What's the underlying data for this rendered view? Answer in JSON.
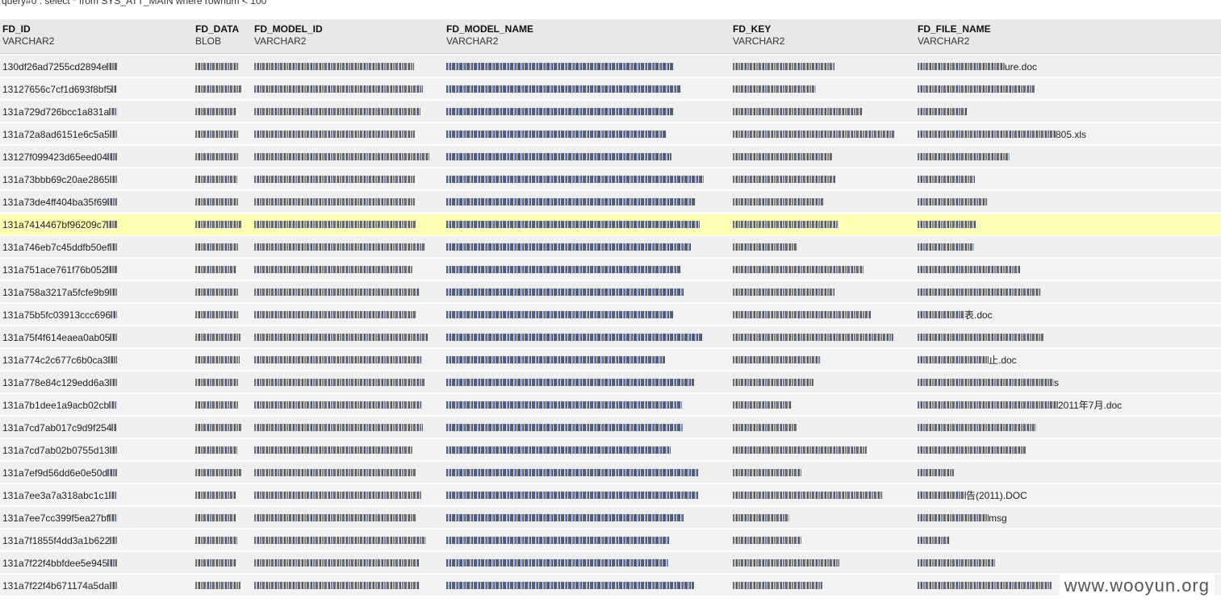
{
  "query": "query#0 : select * from SYS_ATT_MAIN where rownum < 100",
  "columns": [
    {
      "name": "FD_ID",
      "type": "VARCHAR2"
    },
    {
      "name": "FD_DATA",
      "type": "BLOB"
    },
    {
      "name": "FD_MODEL_ID",
      "type": "VARCHAR2"
    },
    {
      "name": "FD_MODEL_NAME",
      "type": "VARCHAR2"
    },
    {
      "name": "FD_KEY",
      "type": "VARCHAR2"
    },
    {
      "name": "FD_FILE_NAME",
      "type": "VARCHAR2"
    }
  ],
  "rows": [
    {
      "fd_id": "130df26ad7255cd2894e",
      "file_suffix": "ure.doc"
    },
    {
      "fd_id": "13127656c7cf1d693f8bf5",
      "file_suffix": ""
    },
    {
      "fd_id": "131a729d726bcc1a831a",
      "file_suffix": ""
    },
    {
      "fd_id": "131a72a8ad6151e6c5a5",
      "file_suffix": "805.xls"
    },
    {
      "fd_id": "13127f099423d65eed04",
      "file_suffix": ""
    },
    {
      "fd_id": "131a73bbb69c20ae2865",
      "file_suffix": ""
    },
    {
      "fd_id": "131a73de4ff404ba35f69",
      "file_suffix": ""
    },
    {
      "fd_id": "131a7414467bf96209c7",
      "file_suffix": ""
    },
    {
      "fd_id": "131a746eb7c45ddfb50ef",
      "file_suffix": ""
    },
    {
      "fd_id": "131a751ace761f76b052",
      "file_suffix": ""
    },
    {
      "fd_id": "131a758a3217a5fcfe9b9",
      "file_suffix": ""
    },
    {
      "fd_id": "131a75b5fc03913ccc696",
      "file_suffix": "表.doc"
    },
    {
      "fd_id": "131a75f4f614eaea0ab05",
      "file_suffix": ""
    },
    {
      "fd_id": "131a774c2c677c6b0ca3",
      "file_suffix": "止.doc"
    },
    {
      "fd_id": "131a778e84c129edd6a3",
      "file_suffix": "s"
    },
    {
      "fd_id": "131a7b1dee1a9acb02cb",
      "file_suffix": "2011年7月.doc"
    },
    {
      "fd_id": "131a7cd7ab017c9d9f254",
      "file_suffix": ""
    },
    {
      "fd_id": "131a7cd7ab02b0755d13",
      "file_suffix": ""
    },
    {
      "fd_id": "131a7ef9d56dd6e0e50d",
      "file_suffix": ""
    },
    {
      "fd_id": "131a7ee3a7a318abc1c1",
      "file_suffix": "告(2011).DOC"
    },
    {
      "fd_id": "131a7ee7cc399f5ea27bf",
      "file_suffix": "msg"
    },
    {
      "fd_id": "131a7f1855f4dd3a1b622",
      "file_suffix": ""
    },
    {
      "fd_id": "131a7f22f4bbfdee5e945",
      "file_suffix": ""
    },
    {
      "fd_id": "131a7f22f4b671174a5da",
      "file_suffix": ""
    }
  ],
  "selected_row_index": 7,
  "watermark": "www.wooyun.org",
  "colors": {
    "header_bg": "#e8e8e8",
    "row_bg": "#efefef",
    "selected_bg": "#ffffb4"
  }
}
